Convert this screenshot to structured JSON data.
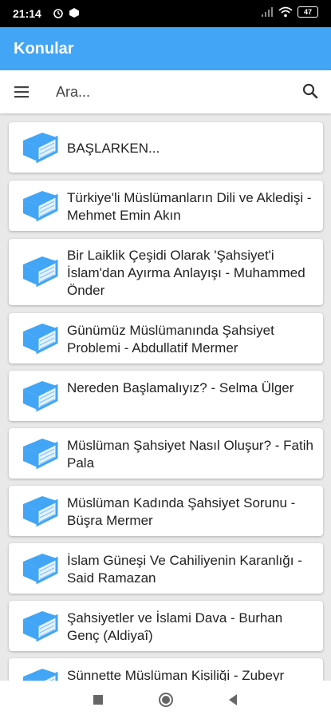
{
  "status_bar": {
    "time": "21:14",
    "battery": "47"
  },
  "app_bar": {
    "title": "Konular"
  },
  "search": {
    "placeholder": "Ara..."
  },
  "topics": [
    {
      "title": "BAŞLARKEN..."
    },
    {
      "title": "Türkiye'li Müslümanların Dili ve Akledişi - Mehmet Emin Akın"
    },
    {
      "title": "Bir Laiklik Çeşidi Olarak 'Şahsiyet'i İslam'dan Ayırma Anlayışı - Muhammed Önder"
    },
    {
      "title": "Günümüz Müslümanında Şahsiyet Problemi - Abdullatif Mermer"
    },
    {
      "title": "Nereden Başlamalıyız? - Selma Ülger"
    },
    {
      "title": "Müslüman Şahsiyet Nasıl Oluşur? - Fatih Pala"
    },
    {
      "title": "Müslüman Kadında Şahsiyet Sorunu - Büşra Mermer"
    },
    {
      "title": "İslam Güneşi Ve Cahiliyenin Karanlığı - Said Ramazan"
    },
    {
      "title": "Şahsiyetler ve İslami Dava - Burhan Genç (Aldiyaî)"
    },
    {
      "title": "Sünnette Müslüman Kişiliği - Zubeyr"
    }
  ],
  "colors": {
    "app_bar": "#42a5f5",
    "book_icon": "#42a5f5"
  }
}
